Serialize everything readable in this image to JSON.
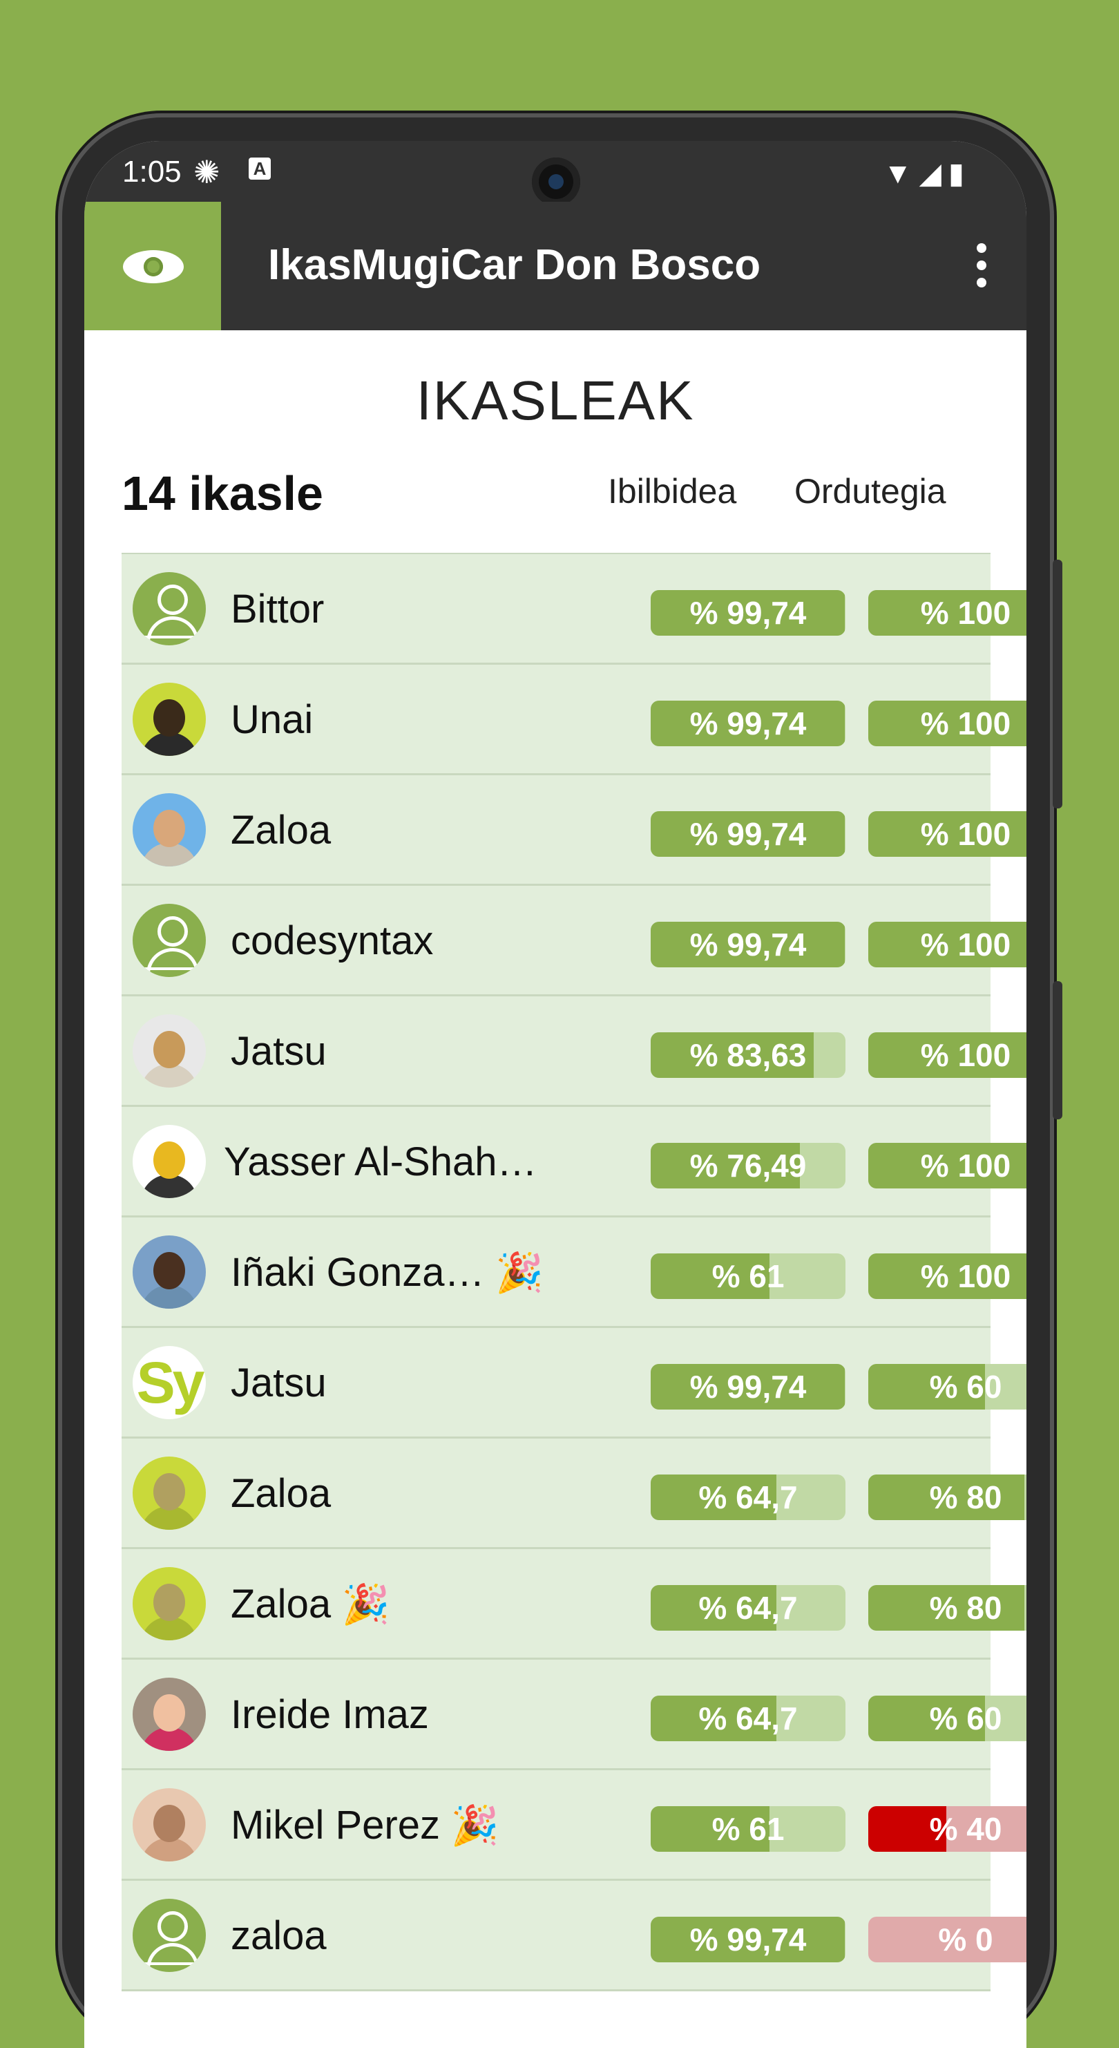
{
  "status": {
    "time": "1:05",
    "icons": "▼◢▮"
  },
  "app": {
    "title": "IkasMugiCar Don Bosco",
    "logo_icon": "eye-globe-icon"
  },
  "page": {
    "heading": "IKASLEAK",
    "count": "14 ikasle",
    "col_route": "Ibilbidea",
    "col_schedule": "Ordutegia"
  },
  "colors": {
    "accent": "#8aaf4d",
    "appbar": "#333333",
    "row_bg": "#e2eedb",
    "danger": "#cc0000"
  },
  "students": [
    {
      "name": "Bittor",
      "party": "",
      "avatar": "default",
      "route_text": "% 99,74",
      "route": 99.74,
      "sched_text": "% 100",
      "sched": 100,
      "sched_status": "ok"
    },
    {
      "name": "Unai",
      "party": "",
      "avatar": "photo-yellow",
      "route_text": "% 99,74",
      "route": 99.74,
      "sched_text": "% 100",
      "sched": 100,
      "sched_status": "ok"
    },
    {
      "name": "Zaloa",
      "party": "",
      "avatar": "photo-beach",
      "route_text": "% 99,74",
      "route": 99.74,
      "sched_text": "% 100",
      "sched": 100,
      "sched_status": "ok"
    },
    {
      "name": "codesyntax",
      "party": "",
      "avatar": "default",
      "route_text": "% 99,74",
      "route": 99.74,
      "sched_text": "% 100",
      "sched": 100,
      "sched_status": "ok"
    },
    {
      "name": "Jatsu",
      "party": "",
      "avatar": "photo-cake",
      "route_text": "% 83,63",
      "route": 83.63,
      "sched_text": "% 100",
      "sched": 100,
      "sched_status": "ok"
    },
    {
      "name": "Yasser Al-Shah…",
      "party": "",
      "avatar": "photo-lego",
      "route_text": "% 76,49",
      "route": 76.49,
      "sched_text": "% 100",
      "sched": 100,
      "sched_status": "ok"
    },
    {
      "name": "Iñaki Gonza…",
      "party": "🎉",
      "avatar": "photo-man",
      "route_text": "% 61",
      "route": 61,
      "sched_text": "% 100",
      "sched": 100,
      "sched_status": "ok"
    },
    {
      "name": "Jatsu",
      "party": "",
      "avatar": "sy",
      "avatar_text": "Sy",
      "route_text": "% 99,74",
      "route": 99.74,
      "sched_text": "% 60",
      "sched": 60,
      "sched_status": "ok"
    },
    {
      "name": "Zaloa",
      "party": "",
      "avatar": "photo-yellow-woman",
      "route_text": "% 64,7",
      "route": 64.7,
      "sched_text": "% 80",
      "sched": 80,
      "sched_status": "ok"
    },
    {
      "name": "Zaloa",
      "party": "🎉",
      "avatar": "photo-yellow-woman",
      "route_text": "% 64,7",
      "route": 64.7,
      "sched_text": "% 80",
      "sched": 80,
      "sched_status": "ok"
    },
    {
      "name": "Ireide Imaz",
      "party": "",
      "avatar": "photo-red-hair",
      "route_text": "% 64,7",
      "route": 64.7,
      "sched_text": "% 60",
      "sched": 60,
      "sched_status": "ok"
    },
    {
      "name": "Mikel Perez",
      "party": "🎉",
      "avatar": "photo-glasses",
      "route_text": "% 61",
      "route": 61,
      "sched_text": "% 40",
      "sched": 40,
      "sched_status": "bad"
    },
    {
      "name": "zaloa",
      "party": "",
      "avatar": "default",
      "route_text": "% 99,74",
      "route": 99.74,
      "sched_text": "% 0",
      "sched": 0,
      "sched_status": "bad"
    }
  ]
}
